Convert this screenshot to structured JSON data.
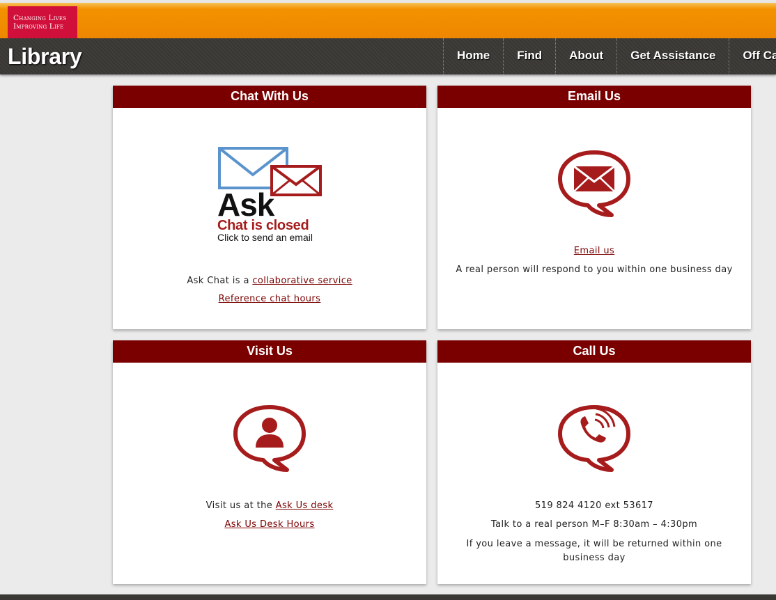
{
  "brand": {
    "logo_line1": "Changing Lives",
    "logo_line2": "Improving Life"
  },
  "header": {
    "title": "Library",
    "nav": [
      "Home",
      "Find",
      "About",
      "Get Assistance",
      "Off Cam"
    ]
  },
  "panels": {
    "chat": {
      "title": "Chat With Us",
      "graphic": {
        "ask": "Ask",
        "status": "Chat is closed",
        "sub": "Click to send an email"
      },
      "text_prefix": "Ask Chat is a ",
      "link1": "collaborative service",
      "link2": "Reference chat hours"
    },
    "email": {
      "title": "Email Us",
      "link": "Email us",
      "text": "A real person will respond to you within one business day"
    },
    "visit": {
      "title": "Visit Us",
      "text_prefix": "Visit us at the ",
      "link1": "Ask Us desk",
      "link2": "Ask Us Desk Hours"
    },
    "call": {
      "title": "Call Us",
      "phone": "519 824 4120 ext 53617",
      "hours": "Talk to a real person M–F 8:30am – 4:30pm",
      "message_note": "If you leave a message, it will be returned within one business day"
    }
  },
  "colors": {
    "accent": "#7a0000",
    "icon_red": "#a61c1c",
    "orange": "#f39200",
    "nav_dark": "#393734",
    "logo_bg": "#d0103a",
    "envelope_blue": "#5b94cc"
  },
  "icons": [
    "envelope-speech-icon",
    "person-speech-icon",
    "phone-speech-icon",
    "ask-chat-envelopes-icon"
  ]
}
